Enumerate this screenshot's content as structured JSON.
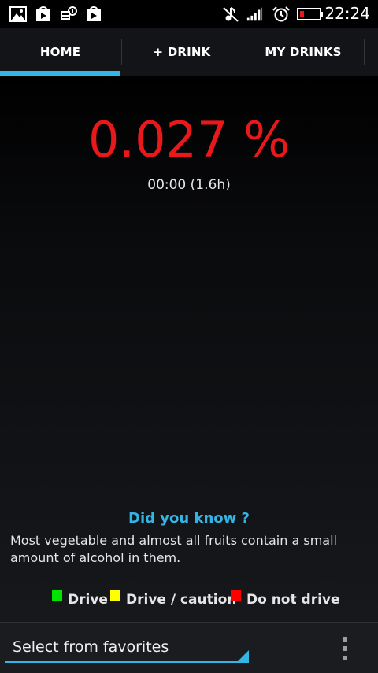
{
  "status_bar": {
    "time": "22:24",
    "icons": [
      "gallery-icon",
      "play-store-icon",
      "voicemail-icon",
      "play-store-icon",
      "muted-icon",
      "signal-icon",
      "alarm-icon",
      "battery-icon"
    ],
    "battery_color": "#e8181b"
  },
  "tabs": [
    {
      "label": "HOME",
      "selected": true
    },
    {
      "label": "+ DRINK",
      "selected": false
    },
    {
      "label": "MY DRINKS",
      "selected": false
    }
  ],
  "main": {
    "bac": "0.027 %",
    "time_info": "00:00 (1.6h)",
    "did_you_know": {
      "title": "Did you know ?",
      "text": "Most vegetable and almost all fruits contain a small amount of alcohol in them."
    },
    "legend": [
      {
        "label": "Drive",
        "color": "#00e400"
      },
      {
        "label": "Drive / caution",
        "color": "#ffff00"
      },
      {
        "label": "Do not drive",
        "color": "#ff0000"
      }
    ]
  },
  "bottom_bar": {
    "favorites_label": "Select from favorites"
  },
  "colors": {
    "accent": "#33b5e5",
    "bac_red": "#e8181b"
  }
}
